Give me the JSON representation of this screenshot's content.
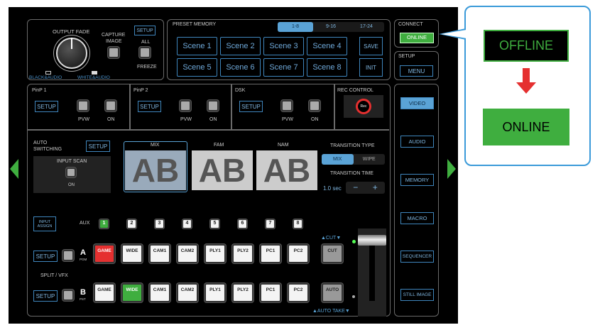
{
  "top_left": {
    "output_fade": "OUTPUT FADE",
    "black_audio": "BLACK&AUDIO",
    "white_audio": "WHITE&AUDIO",
    "capture": "CAPTURE",
    "image": "IMAGE",
    "setup": "SETUP",
    "all": "ALL",
    "freeze": "FREEZE"
  },
  "preset": {
    "title": "PRESET MEMORY",
    "tabs": [
      "1-8",
      "9-16",
      "17-24"
    ],
    "active_tab": "1-8",
    "scenes": [
      "Scene 1",
      "Scene 2",
      "Scene 3",
      "Scene 4",
      "Scene 5",
      "Scene 6",
      "Scene 7",
      "Scene 8"
    ],
    "save": "SAVE",
    "init": "INIT"
  },
  "connect": {
    "title": "CONNECT",
    "status": "ONLINE",
    "setup_title": "SETUP",
    "menu": "MENU"
  },
  "pinp1": {
    "title": "PinP 1",
    "setup": "SETUP",
    "pvw": "PVW",
    "on": "ON"
  },
  "pinp2": {
    "title": "PinP 2",
    "setup": "SETUP",
    "pvw": "PVW",
    "on": "ON"
  },
  "dsk": {
    "title": "DSK",
    "setup": "SETUP",
    "pvw": "PVW",
    "on": "ON"
  },
  "rec": {
    "title": "REC CONTROL",
    "button": "Rec"
  },
  "auto": {
    "title1": "AUTO",
    "title2": "SWITCHING",
    "setup": "SETUP",
    "input_scan": "INPUT SCAN",
    "on": "ON"
  },
  "transitions": {
    "thumbs": [
      "MIX",
      "FAM",
      "NAM"
    ],
    "selected": "MIX",
    "type_title": "TRANSITION TYPE",
    "types": [
      "MIX",
      "WIPE"
    ],
    "active_type": "MIX",
    "time_title": "TRANSITION TIME",
    "time_value": "1.0 sec",
    "minus": "−",
    "plus": "+"
  },
  "aux": {
    "input_assign1": "INPUT",
    "input_assign2": "ASSIGN",
    "label": "AUX",
    "buttons": [
      "1",
      "2",
      "3",
      "4",
      "5",
      "6",
      "7",
      "8"
    ],
    "active": "1"
  },
  "bus_a": {
    "setup": "SETUP",
    "letter": "A",
    "sub": "PGM",
    "inputs": [
      "GAME",
      "WIDE",
      "CAM1",
      "CAM2",
      "PLY1",
      "PLY2",
      "PC1",
      "PC2"
    ],
    "active": "GAME"
  },
  "bus_b": {
    "setup": "SETUP",
    "letter": "B",
    "sub": "PST",
    "inputs": [
      "GAME",
      "WIDE",
      "CAM1",
      "CAM2",
      "PLY1",
      "PLY2",
      "PC1",
      "PC2"
    ],
    "active": "WIDE"
  },
  "split_vfx": "SPLIT / VFX",
  "cut": {
    "label": "▲CUT▼",
    "button": "CUT"
  },
  "auto_take": {
    "label": "▲AUTO TAKE▼",
    "button": "AUTO"
  },
  "nav": [
    "VIDEO",
    "AUDIO",
    "MEMORY",
    "MACRO",
    "SEQUENCER",
    "STILL IMAGE"
  ],
  "nav_active": "VIDEO",
  "callout": {
    "before": "OFFLINE",
    "after": "ONLINE"
  },
  "colors": {
    "accent": "#5aa3d6",
    "pgm": "#e53030",
    "pst": "#3fae3f",
    "online": "#3fae3f",
    "arrow": "#e53030",
    "nav_arrow": "#3fae3f"
  }
}
